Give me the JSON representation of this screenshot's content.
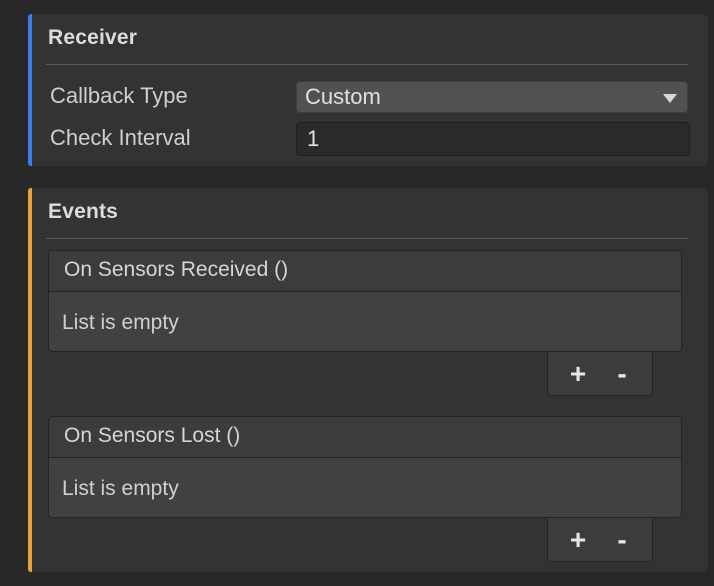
{
  "receiver": {
    "title": "Receiver",
    "accent_color": "#3b7ee8",
    "callback_type": {
      "label": "Callback Type",
      "value": "Custom"
    },
    "check_interval": {
      "label": "Check Interval",
      "value": "1"
    }
  },
  "events": {
    "title": "Events",
    "accent_color": "#e8a33b",
    "items": [
      {
        "header": "On Sensors Received ()",
        "empty_text": "List is empty",
        "add_label": "+",
        "remove_label": "-"
      },
      {
        "header": "On Sensors Lost ()",
        "empty_text": "List is empty",
        "add_label": "+",
        "remove_label": "-"
      }
    ]
  }
}
